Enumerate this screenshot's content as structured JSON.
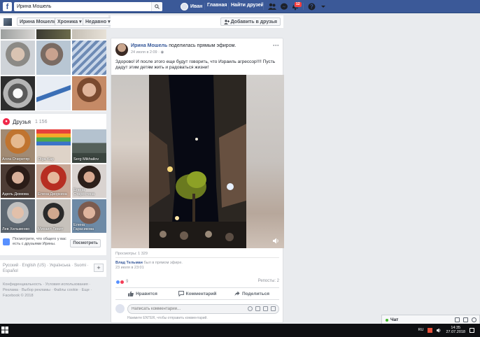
{
  "topbar": {
    "search_value": "Ирина Мошель",
    "user_name": "Иван",
    "home": "Главная",
    "find_friends": "Найти друзей",
    "notif_count": "12"
  },
  "profile_nav": {
    "name": "Ирина Мошель",
    "timeline": "Хроника",
    "recent": "Недавно",
    "add_friend": "Добавить в друзья"
  },
  "friends": {
    "title": "Друзья",
    "count": "1 156",
    "items": [
      {
        "name": "Алла Очеретяр"
      },
      {
        "name": "Olga Kap"
      },
      {
        "name": "Serg Mikhailov"
      },
      {
        "name": "Адель Дюмова"
      },
      {
        "name": "Елена Дворкина"
      },
      {
        "name": "Елена Старостина"
      },
      {
        "name": "Лев Хельменко"
      },
      {
        "name": "Михаил Левит"
      },
      {
        "name": "Елена Гарасикова"
      }
    ],
    "notice": "Посмотрите, что общего у вас есть с друзьями Ирины.",
    "notice_button": "Посмотреть"
  },
  "languages": {
    "line1": "Русский · English (US) · Українська · Suomi ·",
    "line2": "Español"
  },
  "footer": {
    "line1": "Конфиденциальность · Условия использования ·",
    "line2": "Реклама · Выбор рекламы · Файлы cookie · Еще ·",
    "line3": "Facebook © 2018"
  },
  "post": {
    "author": "Ирина Мошель",
    "action": "поделилась прямым эфиром.",
    "time": "24 июля в 2:09 ·",
    "text": "Здорово! И после этого еще будут говорить, что Израиль агрессор!!!! Пусть дадут этим детям жить и радоваться жизни!",
    "views": "Просмотры: 1 329",
    "reshare_author": "Влад Тельман",
    "reshare_action": "был в прямом эфире.",
    "reshare_time": "23 июля в 23:01",
    "reactions_count": "9",
    "reposts": "Репосты: 2",
    "like": "Нравится",
    "comment": "Комментарий",
    "share": "Поделиться",
    "comment_placeholder": "Написать комментарий...",
    "enter_hint": "Нажмите ENTER, чтобы отправить комментарий."
  },
  "chat": {
    "label": "Чат"
  },
  "taskbar": {
    "lang": "RU",
    "time": "14:35",
    "date": "27.07.2018"
  },
  "colors": {
    "facebook_blue": "#3b5998",
    "link": "#365899",
    "page_bg": "#e9ebee"
  }
}
